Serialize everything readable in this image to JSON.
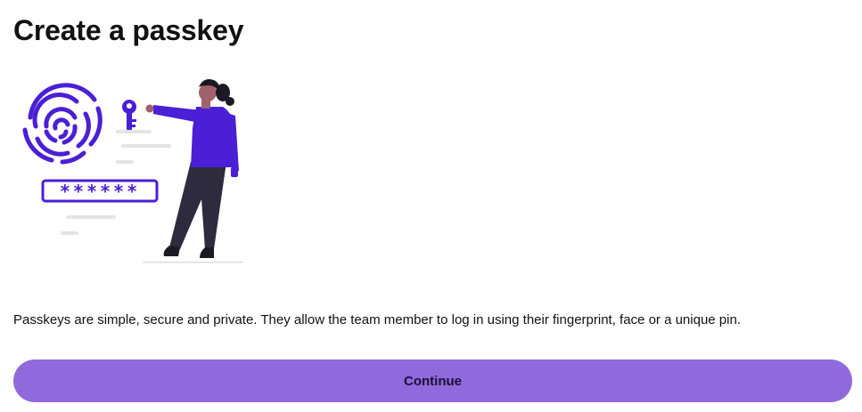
{
  "page": {
    "title": "Create a passkey",
    "description": "Passkeys are simple, secure and private. They allow the team member to log in using their fingerprint, face or a unique pin.",
    "continue_label": "Continue"
  },
  "illustration": {
    "password_mask": "******",
    "accent_color": "#4a1fd6",
    "button_color": "#9069dc"
  }
}
